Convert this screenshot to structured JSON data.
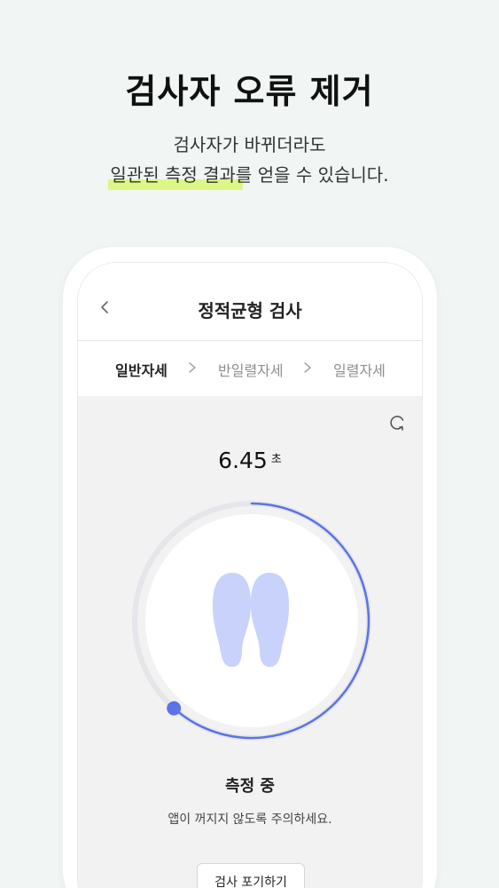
{
  "hero": {
    "title": "검사자 오류 제거",
    "subtitle_line1": "검사자가 바뀌더라도",
    "subtitle_line2": "일관된 측정 결과를 얻을 수 있습니다.",
    "highlight_color": "#d9f77a"
  },
  "screen": {
    "header_title": "정적균형 검사",
    "steps": [
      "일반자세",
      "반일렬자세",
      "일렬자세"
    ],
    "active_step": "일반자세",
    "timer_value": "6.45",
    "timer_unit": "초",
    "status": "측정 중",
    "note": "앱이 꺼지지 않도록 주의하세요.",
    "give_up_label": "검사 포기하기",
    "accent_color": "#5b73e6",
    "foot_color": "#c9d2fb"
  },
  "icons": [
    "back-chevron-icon",
    "chevron-right-icon",
    "refresh-icon",
    "footprints-icon"
  ]
}
